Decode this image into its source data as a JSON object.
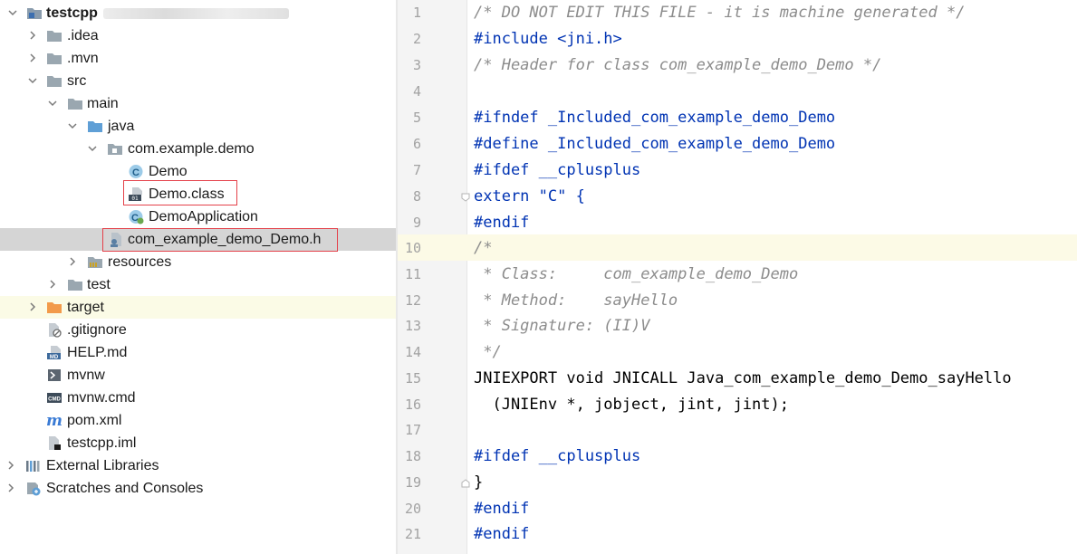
{
  "project_tree": {
    "root": "testcpp",
    "items": [
      {
        "label": "testcpp",
        "icon": "module-folder-icon"
      },
      {
        "label": ".idea",
        "icon": "folder-icon"
      },
      {
        "label": ".mvn",
        "icon": "folder-icon"
      },
      {
        "label": "src",
        "icon": "folder-icon"
      },
      {
        "label": "main",
        "icon": "folder-icon"
      },
      {
        "label": "java",
        "icon": "source-folder-icon"
      },
      {
        "label": "com.example.demo",
        "icon": "package-icon"
      },
      {
        "label": "Demo",
        "icon": "java-class-icon"
      },
      {
        "label": "Demo.class",
        "icon": "binary-class-file-icon"
      },
      {
        "label": "DemoApplication",
        "icon": "spring-class-icon"
      },
      {
        "label": "com_example_demo_Demo.h",
        "icon": "header-file-icon"
      },
      {
        "label": "resources",
        "icon": "resources-folder-icon"
      },
      {
        "label": "test",
        "icon": "folder-icon"
      },
      {
        "label": "target",
        "icon": "excluded-folder-icon"
      },
      {
        "label": ".gitignore",
        "icon": "ignored-file-icon"
      },
      {
        "label": "HELP.md",
        "icon": "markdown-file-icon"
      },
      {
        "label": "mvnw",
        "icon": "shell-file-icon"
      },
      {
        "label": "mvnw.cmd",
        "icon": "cmd-file-icon"
      },
      {
        "label": "pom.xml",
        "icon": "maven-icon"
      },
      {
        "label": "testcpp.iml",
        "icon": "iml-file-icon"
      },
      {
        "label": "External Libraries",
        "icon": "libraries-icon"
      },
      {
        "label": "Scratches and Consoles",
        "icon": "scratches-icon"
      }
    ]
  },
  "editor": {
    "file": "com_example_demo_Demo.h",
    "current_line": 10,
    "lines": [
      {
        "n": "1",
        "text": "/* DO NOT EDIT THIS FILE - it is machine generated */"
      },
      {
        "n": "2",
        "text": "#include <jni.h>"
      },
      {
        "n": "3",
        "text": "/* Header for class com_example_demo_Demo */"
      },
      {
        "n": "4",
        "text": ""
      },
      {
        "n": "5",
        "text": "#ifndef _Included_com_example_demo_Demo"
      },
      {
        "n": "6",
        "text": "#define _Included_com_example_demo_Demo"
      },
      {
        "n": "7",
        "text": "#ifdef __cplusplus"
      },
      {
        "n": "8",
        "text": "extern \"C\" {"
      },
      {
        "n": "9",
        "text": "#endif"
      },
      {
        "n": "10",
        "text": "/*"
      },
      {
        "n": "11",
        "text": " * Class:     com_example_demo_Demo"
      },
      {
        "n": "12",
        "text": " * Method:    sayHello"
      },
      {
        "n": "13",
        "text": " * Signature: (II)V"
      },
      {
        "n": "14",
        "text": " */"
      },
      {
        "n": "15",
        "text": "JNIEXPORT void JNICALL Java_com_example_demo_Demo_sayHello"
      },
      {
        "n": "16",
        "text": "  (JNIEnv *, jobject, jint, jint);"
      },
      {
        "n": "17",
        "text": ""
      },
      {
        "n": "18",
        "text": "#ifdef __cplusplus"
      },
      {
        "n": "19",
        "text": "}"
      },
      {
        "n": "20",
        "text": "#endif"
      },
      {
        "n": "21",
        "text": "#endif"
      }
    ]
  },
  "colors": {
    "keyword": "#0033b3",
    "comment": "#8c8c8c",
    "string": "#067d17",
    "selection": "#d5d5d5",
    "highlight_box": "#e4414a"
  }
}
